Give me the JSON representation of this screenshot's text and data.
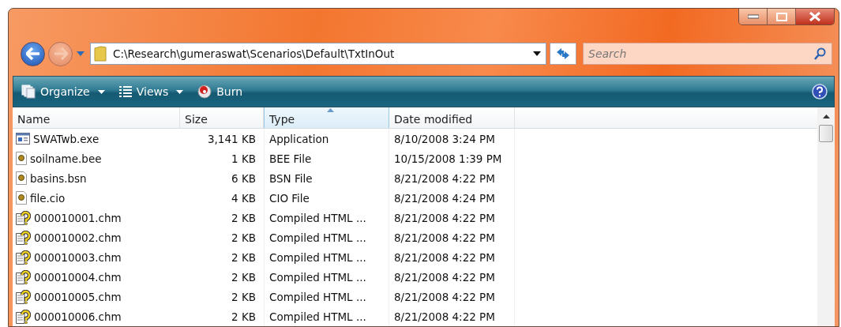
{
  "address_bar": {
    "path": "C:\\Research\\gumeraswat\\Scenarios\\Default\\TxtInOut"
  },
  "search": {
    "placeholder": "Search"
  },
  "toolbar": [
    {
      "label": "Organize",
      "kind": "organize"
    },
    {
      "label": "Views",
      "kind": "views"
    },
    {
      "label": "Burn",
      "kind": "burn"
    }
  ],
  "table": {
    "columns": [
      {
        "label": "Name",
        "sorted": false
      },
      {
        "label": "Size",
        "sorted": false
      },
      {
        "label": "Type",
        "sorted": true
      },
      {
        "label": "Date modified",
        "sorted": false
      }
    ],
    "rows": [
      {
        "kind": "application",
        "name": "SWATwb.exe",
        "size": "3,141 KB",
        "type": "Application",
        "date": "8/10/2008 3:24 PM"
      },
      {
        "kind": "data",
        "name": "soilname.bee",
        "size": "1 KB",
        "type": "BEE File",
        "date": "10/15/2008 1:39 PM"
      },
      {
        "kind": "data",
        "name": "basins.bsn",
        "size": "6 KB",
        "type": "BSN File",
        "date": "8/21/2008 4:22 PM"
      },
      {
        "kind": "data",
        "name": "file.cio",
        "size": "4 KB",
        "type": "CIO File",
        "date": "8/21/2008 4:24 PM"
      },
      {
        "kind": "help",
        "name": "000010001.chm",
        "size": "2 KB",
        "type": "Compiled HTML ...",
        "date": "8/21/2008 4:22 PM"
      },
      {
        "kind": "help",
        "name": "000010002.chm",
        "size": "2 KB",
        "type": "Compiled HTML ...",
        "date": "8/21/2008 4:22 PM"
      },
      {
        "kind": "help",
        "name": "000010003.chm",
        "size": "2 KB",
        "type": "Compiled HTML ...",
        "date": "8/21/2008 4:22 PM"
      },
      {
        "kind": "help",
        "name": "000010004.chm",
        "size": "2 KB",
        "type": "Compiled HTML ...",
        "date": "8/21/2008 4:22 PM"
      },
      {
        "kind": "help",
        "name": "000010005.chm",
        "size": "2 KB",
        "type": "Compiled HTML ...",
        "date": "8/21/2008 4:22 PM"
      },
      {
        "kind": "help",
        "name": "000010006.chm",
        "size": "2 KB",
        "type": "Compiled HTML ...",
        "date": "8/21/2008 4:22 PM"
      }
    ]
  }
}
